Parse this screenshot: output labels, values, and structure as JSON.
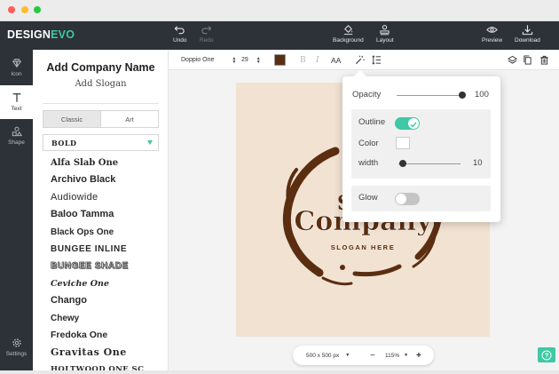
{
  "app": {
    "logo_design": "DESIGN",
    "logo_evo": "EVO",
    "accent": "#3ec8a4",
    "topbar_bg": "#2d3238"
  },
  "topbar": {
    "undo": "Undo",
    "redo": "Redo",
    "background": "Background",
    "layout": "Layout",
    "preview": "Preview",
    "download": "Download"
  },
  "leftbar": {
    "icon": "Icon",
    "text": "Text",
    "shape": "Shape",
    "settings": "Settings"
  },
  "panel": {
    "company_name": "Add Company Name",
    "slogan": "Add Slogan",
    "tab_classic": "Classic",
    "tab_art": "Art",
    "selected_font": "BOLD",
    "fonts": [
      "Alfa Slab One",
      "Archivo Black",
      "Audiowide",
      "Baloo Tamma",
      "Black Ops One",
      "BUNGEE INLINE",
      "BUNGEE SHADE",
      "Ceviche One",
      "Chango",
      "Chewy",
      "Fredoka One",
      "Gravitas One",
      "HOLTWOOD ONE SC"
    ]
  },
  "toolbar": {
    "font_family": "Doppio One",
    "font_size": "29",
    "text_color": "#5b2e11",
    "bold": "B",
    "italic": "I",
    "case": "AA"
  },
  "canvas": {
    "background_color": "#f2e2d2",
    "logo_main": "Company",
    "logo_partial": "S",
    "logo_slogan": "SLOGAN HERE",
    "logo_color": "#5b2e11"
  },
  "zoombar": {
    "size": "500 x 500 px",
    "zoom": "115%",
    "minus": "−",
    "plus": "+"
  },
  "effects": {
    "opacity_label": "Opacity",
    "opacity_value": "100",
    "opacity_fraction": 1.0,
    "outline_label": "Outline",
    "outline_on": true,
    "color_label": "Color",
    "outline_color": "#ffffff",
    "width_label": "width",
    "width_value": "10",
    "glow_label": "Glow",
    "glow_on": false
  }
}
